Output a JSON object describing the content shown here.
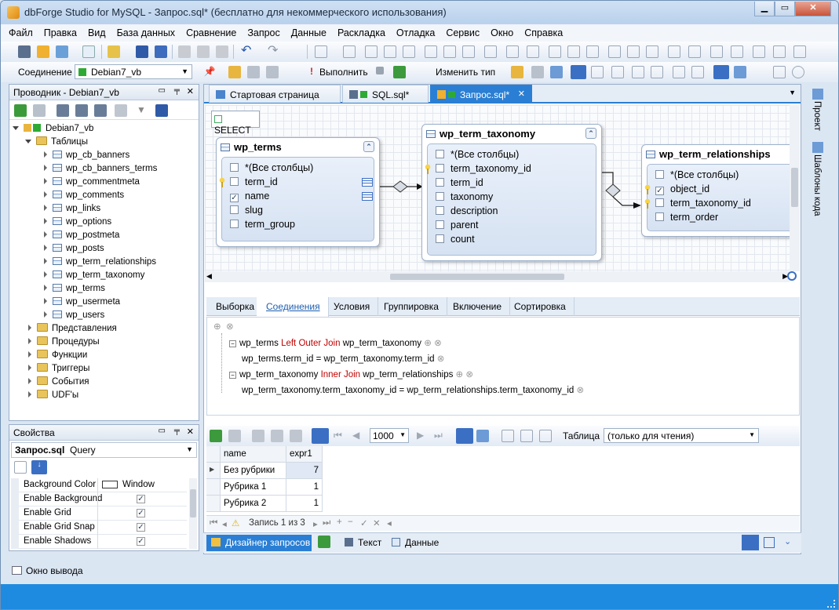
{
  "title": "dbForge Studio for MySQL - Запрос.sql* (бесплатно для некоммерческого использования)",
  "menu": [
    "Файл",
    "Правка",
    "Вид",
    "База данных",
    "Сравнение",
    "Запрос",
    "Данные",
    "Раскладка",
    "Отладка",
    "Сервис",
    "Окно",
    "Справка"
  ],
  "toolbar": {
    "connection_label": "Соединение",
    "connection_value": "Debian7_vb",
    "execute_label": "Выполнить",
    "change_type_label": "Изменить тип"
  },
  "explorer": {
    "title": "Проводник - Debian7_vb",
    "root": "Debian7_vb",
    "tables_folder": "Таблицы",
    "tables": [
      "wp_cb_banners",
      "wp_cb_banners_terms",
      "wp_commentmeta",
      "wp_comments",
      "wp_links",
      "wp_options",
      "wp_postmeta",
      "wp_posts",
      "wp_term_relationships",
      "wp_term_taxonomy",
      "wp_terms",
      "wp_usermeta",
      "wp_users"
    ],
    "folders": [
      "Представления",
      "Процедуры",
      "Функции",
      "Триггеры",
      "События",
      "UDF'ы"
    ]
  },
  "properties": {
    "title": "Свойства",
    "object_name": "Запрос.sql",
    "object_type": "Query",
    "rows": [
      {
        "name": "Background Color",
        "value": "Window",
        "check": false
      },
      {
        "name": "Enable Background",
        "value": "",
        "check": true
      },
      {
        "name": "Enable Grid",
        "value": "",
        "check": true
      },
      {
        "name": "Enable Grid Snap",
        "value": "",
        "check": true
      },
      {
        "name": "Enable Shadows",
        "value": "",
        "check": true
      }
    ]
  },
  "output_window": "Окно вывода",
  "doc_tabs": [
    "Стартовая страница",
    "SQL.sql*",
    "Запрос.sql*"
  ],
  "right_tabs": [
    "Проект",
    "Шаблоны кода"
  ],
  "designer": {
    "select_label": "SELECT",
    "entities": [
      {
        "name": "wp_terms",
        "fields": [
          {
            "label": "*(Все столбцы)",
            "checked": false,
            "key": false
          },
          {
            "label": "term_id",
            "checked": false,
            "key": true
          },
          {
            "label": "name",
            "checked": true,
            "key": false
          },
          {
            "label": "slug",
            "checked": false,
            "key": false
          },
          {
            "label": "term_group",
            "checked": false,
            "key": false
          }
        ]
      },
      {
        "name": "wp_term_taxonomy",
        "fields": [
          {
            "label": "*(Все столбцы)",
            "checked": false,
            "key": false
          },
          {
            "label": "term_taxonomy_id",
            "checked": false,
            "key": true
          },
          {
            "label": "term_id",
            "checked": false,
            "key": false
          },
          {
            "label": "taxonomy",
            "checked": false,
            "key": false
          },
          {
            "label": "description",
            "checked": false,
            "key": false
          },
          {
            "label": "parent",
            "checked": false,
            "key": false
          },
          {
            "label": "count",
            "checked": false,
            "key": false
          }
        ]
      },
      {
        "name": "wp_term_relationships",
        "fields": [
          {
            "label": "*(Все столбцы)",
            "checked": false,
            "key": false
          },
          {
            "label": "object_id",
            "checked": true,
            "key": true
          },
          {
            "label": "term_taxonomy_id",
            "checked": false,
            "key": true
          },
          {
            "label": "term_order",
            "checked": false,
            "key": false
          }
        ]
      }
    ]
  },
  "query_tabs": [
    "Выборка",
    "Соединения",
    "Условия",
    "Группировка",
    "Включение",
    "Сортировка"
  ],
  "joins": [
    {
      "left": "wp_terms",
      "type": "Left Outer Join",
      "right": "wp_term_taxonomy",
      "cond_left": "wp_terms.term_id",
      "op": "=",
      "cond_right": "wp_term_taxonomy.term_id"
    },
    {
      "left": "wp_term_taxonomy",
      "type": "Inner Join",
      "right": "wp_term_relationships",
      "cond_left": "wp_term_taxonomy.term_taxonomy_id",
      "op": "=",
      "cond_right": "wp_term_relationships.term_taxonomy_id"
    }
  ],
  "results": {
    "page_size": "1000",
    "table_label": "Таблица",
    "mode": "(только для чтения)",
    "columns": [
      "name",
      "expr1"
    ],
    "rows": [
      [
        "Без рубрики",
        "7"
      ],
      [
        "Рубрика 1",
        "1"
      ],
      [
        "Рубрика 2",
        "1"
      ]
    ],
    "record_nav": "Запись 1 из 3"
  },
  "bottom_tabs": [
    "Дизайнер запросов",
    "Текст",
    "Данные"
  ],
  "colors": {
    "accent": "#1e8be0",
    "keyword": "#c00000",
    "link": "#1f5fb0"
  }
}
